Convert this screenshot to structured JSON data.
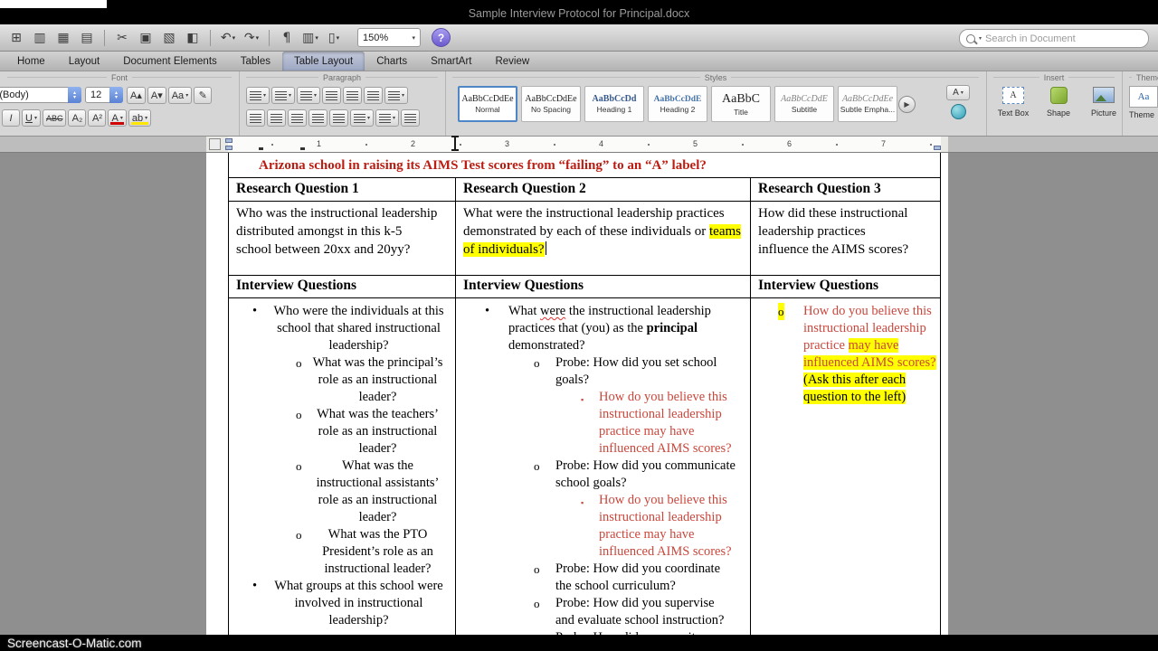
{
  "titlebar": {
    "title": "Sample Interview Protocol for Principal.docx"
  },
  "toolbar": {
    "zoom": "150%",
    "help": "?",
    "search_placeholder": "Search in Document",
    "icons": [
      {
        "name": "gallery",
        "glyph": "⊞"
      },
      {
        "name": "open",
        "glyph": "▥"
      },
      {
        "name": "save",
        "glyph": "▦"
      },
      {
        "name": "print",
        "glyph": "▤"
      },
      {
        "type": "sep"
      },
      {
        "name": "cut",
        "glyph": "✂"
      },
      {
        "name": "copy",
        "glyph": "▣"
      },
      {
        "name": "paste",
        "glyph": "▧"
      },
      {
        "name": "format-painter",
        "glyph": "◧"
      },
      {
        "type": "sep"
      },
      {
        "name": "undo",
        "glyph": "↶",
        "dd": true
      },
      {
        "name": "redo",
        "glyph": "↷",
        "dd": true
      },
      {
        "type": "sep"
      },
      {
        "name": "pilcrow",
        "glyph": "¶"
      },
      {
        "name": "columns",
        "glyph": "▥",
        "dd": true
      },
      {
        "name": "show-document",
        "glyph": "▯",
        "dd": true
      }
    ]
  },
  "tabs": {
    "items": [
      "Home",
      "Layout",
      "Document Elements",
      "Tables",
      "Table Layout",
      "Charts",
      "SmartArt",
      "Review"
    ],
    "active": "Table Layout"
  },
  "ribbon": {
    "groups": {
      "font": "Font",
      "paragraph": "Paragraph",
      "styles": "Styles",
      "insert": "Insert",
      "theme": "Theme"
    },
    "font": {
      "family": "oria (Body)",
      "size": "12",
      "row1_buttons": [
        {
          "name": "grow-font",
          "glyph": "A▴"
        },
        {
          "name": "shrink-font",
          "glyph": "A▾"
        },
        {
          "name": "change-case",
          "glyph": "Aa",
          "dd": true
        },
        {
          "name": "clear-formatting",
          "glyph": "✎"
        }
      ],
      "row2_buttons": [
        {
          "name": "italic",
          "glyph": "I",
          "italic": true
        },
        {
          "name": "underline",
          "glyph": "U",
          "underline": true,
          "dd": true
        },
        {
          "name": "strikethrough",
          "glyph": "ABC",
          "strike": true
        },
        {
          "name": "subscript",
          "glyph": "A₂"
        },
        {
          "name": "superscript",
          "glyph": "A²"
        },
        {
          "name": "font-color",
          "glyph": "A",
          "bar": "#d00000",
          "dd": true
        },
        {
          "name": "highlight",
          "glyph": "ab",
          "bar": "#ffe600",
          "dd": true
        }
      ]
    },
    "paragraph_row1": [
      {
        "name": "bullets",
        "dd": true
      },
      {
        "name": "numbering",
        "dd": true
      },
      {
        "name": "multilevel-list",
        "dd": true
      },
      {
        "name": "decrease-indent"
      },
      {
        "name": "increase-indent"
      },
      {
        "name": "text-direction"
      },
      {
        "name": "line-spacing",
        "dd": true
      }
    ],
    "paragraph_row2": [
      {
        "name": "align-left"
      },
      {
        "name": "align-center"
      },
      {
        "name": "align-right"
      },
      {
        "name": "justify"
      },
      {
        "name": "sort"
      },
      {
        "name": "borders",
        "dd": true
      },
      {
        "name": "shading",
        "dd": true
      },
      {
        "name": "show-marks"
      }
    ],
    "styles": [
      {
        "preview": "AaBbCcDdEe",
        "label": "Normal",
        "cls": "normal",
        "selected": true
      },
      {
        "preview": "AaBbCcDdEe",
        "label": "No Spacing",
        "cls": "nospacing"
      },
      {
        "preview": "AaBbCcDd",
        "label": "Heading 1",
        "cls": "h1"
      },
      {
        "preview": "AaBbCcDdE",
        "label": "Heading 2",
        "cls": "h2"
      },
      {
        "preview": "AaBbC",
        "label": "Title",
        "cls": "title"
      },
      {
        "preview": "AaBbCcDdE",
        "label": "Subtitle",
        "cls": "subtitle"
      },
      {
        "preview": "AaBbCcDdEe",
        "label": "Subtle Empha...",
        "cls": "subtle"
      }
    ],
    "insert": [
      {
        "name": "text-box",
        "label": "Text Box"
      },
      {
        "name": "shape",
        "label": "Shape"
      },
      {
        "name": "picture",
        "label": "Picture"
      }
    ],
    "theme": {
      "chip": "Aa",
      "label": "Theme"
    }
  },
  "ruler": {
    "numbers": [
      "1",
      "2",
      "3",
      "4",
      "5",
      "6",
      "7"
    ]
  },
  "document": {
    "overarching_question": "Arizona school in raising its AIMS Test scores from “failing” to an “A” label?",
    "columns": [
      {
        "header": "Research Question 1",
        "question": "Who was the instructional leadership distributed amongst in this k-5 school between 20xx and 20yy?",
        "iq_header": "Interview Questions",
        "items": [
          {
            "level": 1,
            "text": "Who were the individuals at this school that shared instructional leadership?"
          },
          {
            "level": 2,
            "text": "What was the principal’s role as an instructional leader?"
          },
          {
            "level": 2,
            "text": "What was the teachers’ role as an instructional leader?"
          },
          {
            "level": 2,
            "text": "What was the instructional assistants’ role as an instructional leader?"
          },
          {
            "level": 2,
            "text": "What was the PTO President’s role as an instructional leader?"
          },
          {
            "level": 1,
            "text": "What groups at this school were involved in instructional leadership?"
          }
        ]
      },
      {
        "header": "Research Question 2",
        "question_segments": [
          {
            "text": "What were the instructional leadership practices demonstrated by each of these individuals or "
          },
          {
            "text": "teams of individuals?",
            "highlight": true
          }
        ],
        "caret": true,
        "iq_header": "Interview Questions",
        "items": [
          {
            "level": 1,
            "segments": [
              {
                "text": "What "
              },
              {
                "text": "were",
                "spell": true
              },
              {
                "text": " the instructional leadership practices that (you) as the "
              },
              {
                "text": "principal",
                "bold": true
              },
              {
                "text": " demonstrated?"
              }
            ]
          },
          {
            "level": 2,
            "text": "Probe: How did you set school goals?"
          },
          {
            "level": 3,
            "red": true,
            "text": "How do you believe this instructional leadership practice may have influenced AIMS scores?"
          },
          {
            "level": 2,
            "text": "Probe:  How did you communicate school goals?"
          },
          {
            "level": 3,
            "red": true,
            "text": "How do you believe this instructional leadership practice may have influenced AIMS scores?"
          },
          {
            "level": 2,
            "text": "Probe:  How did you coordinate the school curriculum?"
          },
          {
            "level": 2,
            "text": "Probe:  How did you supervise and evaluate school instruction?"
          },
          {
            "level": 2,
            "text": "Probe:  How did you monitor"
          }
        ]
      },
      {
        "header": "Research Question 3",
        "question": "How did these instructional leadership practices influence the AIMS scores?",
        "iq_header": "Interview Questions",
        "items": [
          {
            "level": 2,
            "bullet_highlight": true,
            "segments": [
              {
                "text": "How do you believe this instructional leadership practice ",
                "red": true
              },
              {
                "text": "may have influenced AIMS scores?",
                "red": true,
                "highlight": true
              },
              {
                "text": " (Ask this after each question to the left)",
                "highlight": true
              }
            ]
          }
        ]
      }
    ]
  },
  "watermark": "Screencast-O-Matic.com",
  "colors": {
    "highlight": "#ffff00",
    "question_red": "#bb1d12",
    "probe_red": "#c9473c",
    "heading_blue": "#36598c",
    "selection_blue": "#4e86c6"
  }
}
